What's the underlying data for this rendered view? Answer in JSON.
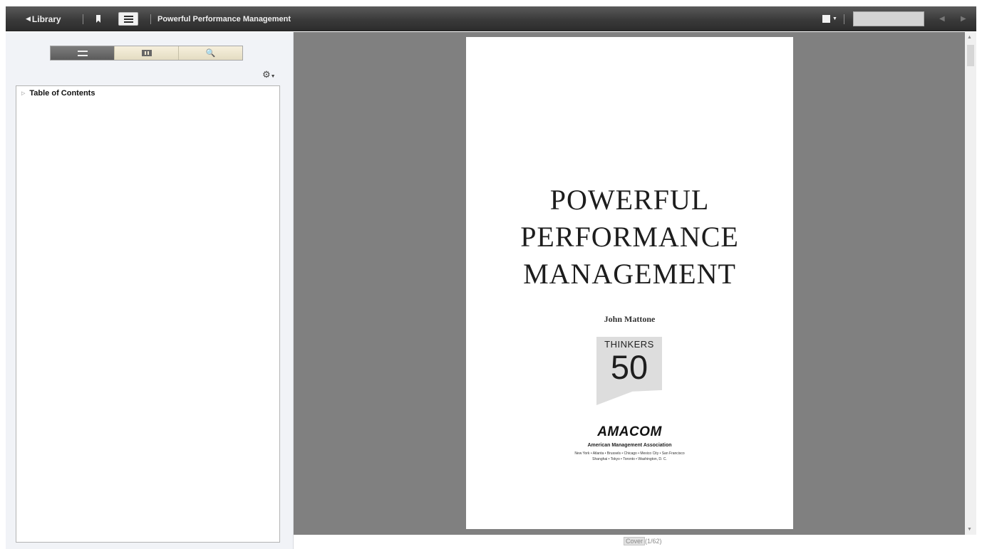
{
  "toolbar": {
    "library_arrow": "◀",
    "library_label": "Library",
    "book_title": "Powerful Performance Management",
    "view_dropdown_caret": "▼",
    "page_input_value": "",
    "prev_arrow": "◀",
    "next_arrow": "▶",
    "icons": [
      "bookmark-icon",
      "toc-icon",
      "view-mode-icon"
    ]
  },
  "sidebar": {
    "tabs": [
      {
        "icon": "contents-tab-icon",
        "active": true
      },
      {
        "icon": "thumbnails-tab-icon",
        "active": false
      },
      {
        "icon": "search-tab-icon",
        "glyph": "🔍",
        "active": false
      }
    ],
    "settings_glyph": "⚙",
    "settings_caret": "▼",
    "toc": {
      "expand_glyph": "▷",
      "label": "Table of Contents"
    }
  },
  "page": {
    "title_lines": [
      "POWERFUL",
      "PERFORMANCE",
      "MANAGEMENT"
    ],
    "author": "John Mattone",
    "logo_word": "THINKERS",
    "logo_number": "50",
    "publisher": "AMACOM",
    "publisher_full": "American Management Association",
    "cities_line1": "New York • Atlanta • Brussels • Chicago • Mexico City • San Francisco",
    "cities_line2": "Shanghai • Tokyo • Toronto • Washington, D. C."
  },
  "status": {
    "section": "Cover",
    "position": "(1/62)"
  },
  "colors": {
    "toolbar": "#3a3a3a",
    "viewer_background": "#808080",
    "sidebar_background": "#f1f3f7"
  }
}
